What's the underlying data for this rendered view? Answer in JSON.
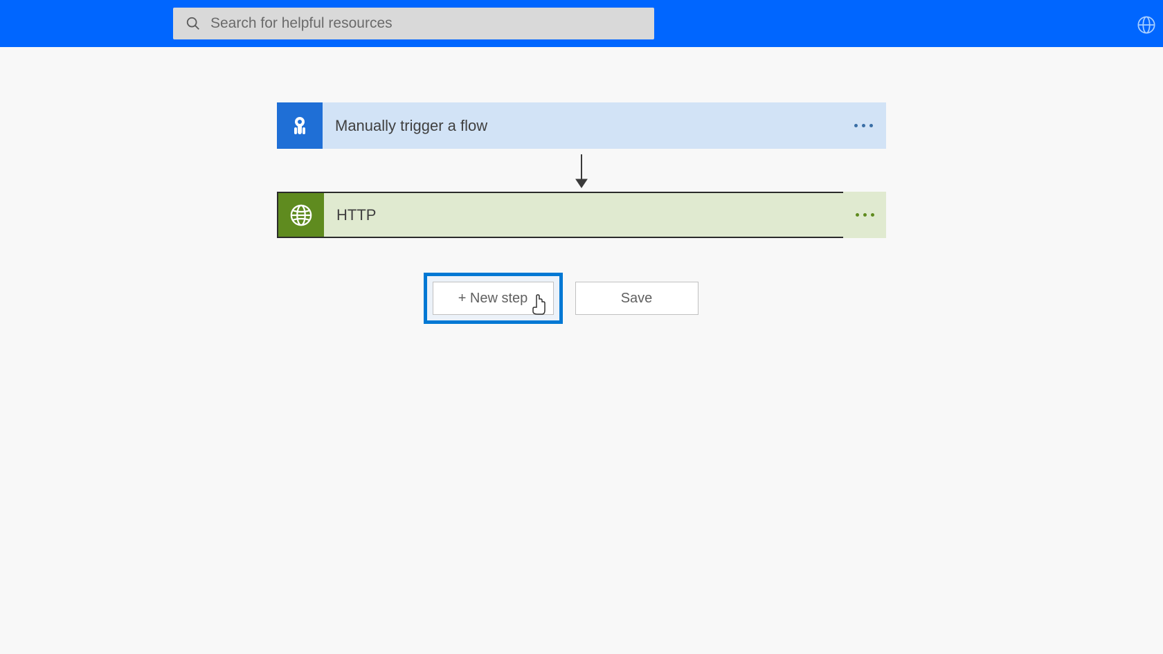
{
  "header": {
    "search_placeholder": "Search for helpful resources"
  },
  "flow": {
    "trigger": {
      "title": "Manually trigger a flow"
    },
    "action": {
      "title": "HTTP"
    }
  },
  "buttons": {
    "new_step": "+ New step",
    "save": "Save"
  }
}
